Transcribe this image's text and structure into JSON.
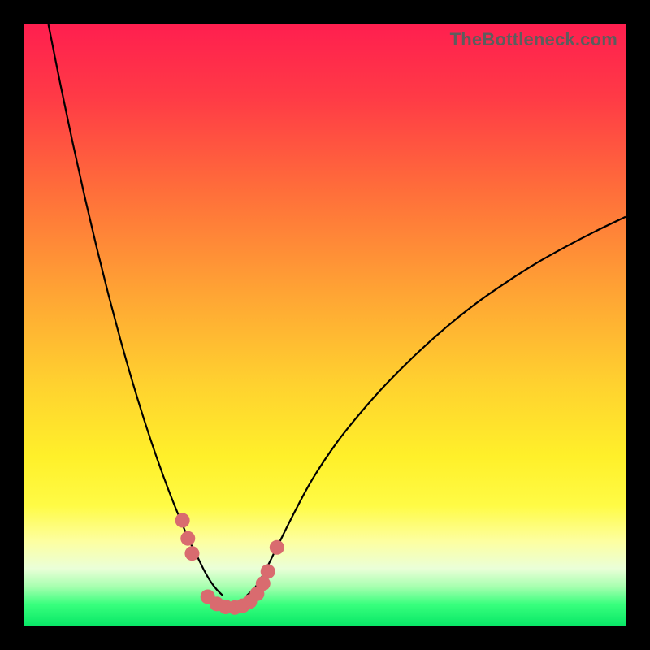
{
  "watermark": "TheBottleneck.com",
  "chart_data": {
    "type": "line",
    "title": "",
    "xlabel": "",
    "ylabel": "",
    "xlim": [
      0,
      100
    ],
    "ylim": [
      0,
      100
    ],
    "background_gradient": {
      "stops": [
        {
          "pos": 0.0,
          "color": "#ff1f4f"
        },
        {
          "pos": 0.12,
          "color": "#ff3a46"
        },
        {
          "pos": 0.28,
          "color": "#ff6f3a"
        },
        {
          "pos": 0.45,
          "color": "#ffa534"
        },
        {
          "pos": 0.6,
          "color": "#ffd22f"
        },
        {
          "pos": 0.72,
          "color": "#fff02a"
        },
        {
          "pos": 0.8,
          "color": "#fffb45"
        },
        {
          "pos": 0.86,
          "color": "#fdffa1"
        },
        {
          "pos": 0.905,
          "color": "#eaffd8"
        },
        {
          "pos": 0.935,
          "color": "#a8ffb0"
        },
        {
          "pos": 0.965,
          "color": "#38ff7d"
        },
        {
          "pos": 1.0,
          "color": "#09e867"
        }
      ]
    },
    "series": [
      {
        "name": "left-curve",
        "stroke": "#000000",
        "stroke_width": 2.2,
        "x": [
          4.0,
          6.0,
          8.0,
          10.0,
          12.0,
          14.0,
          16.0,
          18.0,
          20.0,
          22.0,
          24.0,
          26.0,
          27.5,
          29.0,
          30.0,
          31.0,
          32.0,
          33.0
        ],
        "y": [
          100.0,
          90.0,
          80.5,
          71.5,
          63.0,
          55.0,
          47.5,
          40.5,
          34.0,
          28.0,
          22.5,
          17.5,
          14.0,
          11.0,
          9.0,
          7.3,
          6.0,
          5.0
        ]
      },
      {
        "name": "right-curve",
        "stroke": "#000000",
        "stroke_width": 2.2,
        "x": [
          37.0,
          38.5,
          40.0,
          42.0,
          45.0,
          48.0,
          52.0,
          56.0,
          60.0,
          65.0,
          70.0,
          75.0,
          80.0,
          85.0,
          90.0,
          95.0,
          100.0
        ],
        "y": [
          5.0,
          6.5,
          9.0,
          13.0,
          19.0,
          24.5,
          30.5,
          35.5,
          40.0,
          45.0,
          49.5,
          53.5,
          57.0,
          60.2,
          63.0,
          65.6,
          68.0
        ]
      }
    ],
    "markers": {
      "name": "data-points",
      "color": "#d96b6f",
      "radius": 9,
      "points": [
        {
          "x": 26.3,
          "y": 17.5
        },
        {
          "x": 27.2,
          "y": 14.5
        },
        {
          "x": 27.9,
          "y": 12.0
        },
        {
          "x": 30.5,
          "y": 4.8
        },
        {
          "x": 32.0,
          "y": 3.6
        },
        {
          "x": 33.5,
          "y": 3.1
        },
        {
          "x": 35.0,
          "y": 3.0
        },
        {
          "x": 36.3,
          "y": 3.3
        },
        {
          "x": 37.5,
          "y": 4.0
        },
        {
          "x": 38.7,
          "y": 5.3
        },
        {
          "x": 39.7,
          "y": 7.0
        },
        {
          "x": 40.5,
          "y": 9.0
        },
        {
          "x": 42.0,
          "y": 13.0
        }
      ]
    }
  }
}
